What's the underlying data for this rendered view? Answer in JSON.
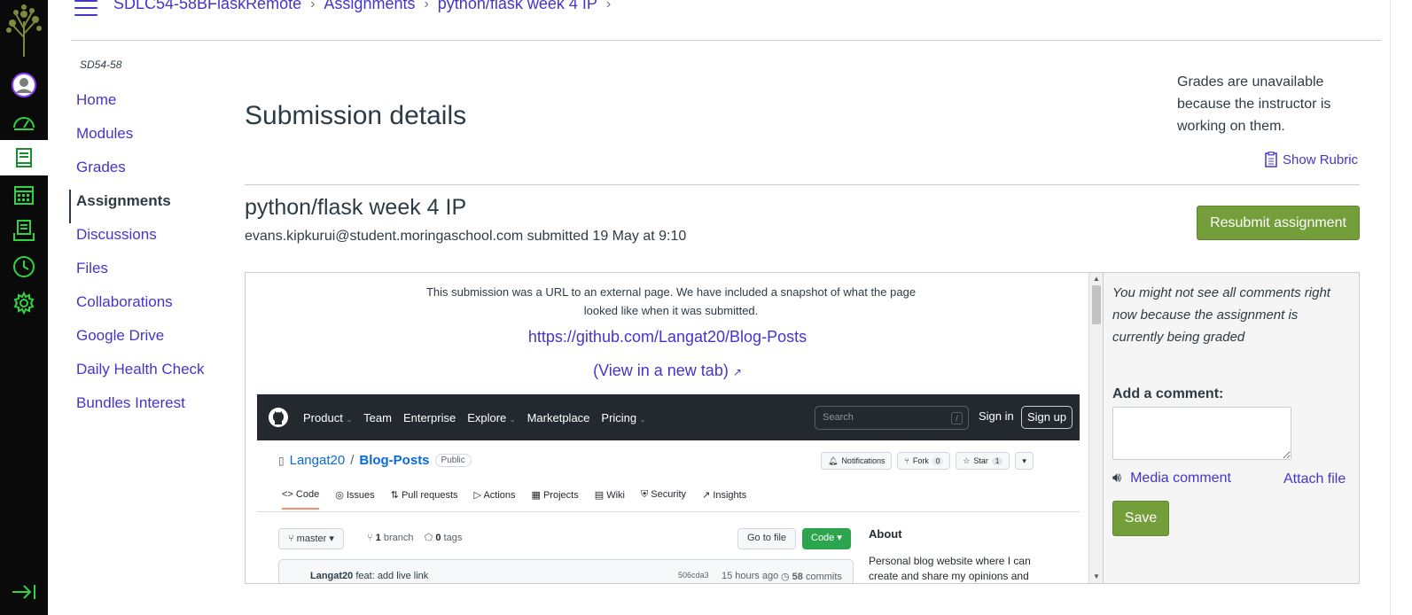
{
  "breadcrumb": {
    "items": [
      "SDLC54-58BFlaskRemote",
      "Assignments",
      "python/flask week 4 IP"
    ]
  },
  "course_nav": {
    "code": "SD54-58",
    "items": [
      {
        "label": "Home"
      },
      {
        "label": "Modules"
      },
      {
        "label": "Grades"
      },
      {
        "label": "Assignments"
      },
      {
        "label": "Discussions"
      },
      {
        "label": "Files"
      },
      {
        "label": "Collaborations"
      },
      {
        "label": "Google Drive"
      },
      {
        "label": "Daily Health Check"
      },
      {
        "label": "Bundles Interest"
      }
    ]
  },
  "page": {
    "title": "Submission details",
    "grades_note": "Grades are unavailable because the instructor is working on them.",
    "show_rubric": "Show Rubric",
    "assignment_name": "python/flask week 4 IP",
    "submitted_line": "evans.kipkurui@student.moringaschool.com submitted 19 May at 9:10",
    "resubmit_label": "Resubmit assignment"
  },
  "snapshot": {
    "note": "This submission was a URL to an external page. We have included a snapshot of what the page looked like when it was submitted.",
    "url": "https://github.com/Langat20/Blog-Posts",
    "new_tab": "(View in a new tab)"
  },
  "github": {
    "menu": [
      "Product",
      "Team",
      "Enterprise",
      "Explore",
      "Marketplace",
      "Pricing"
    ],
    "search_placeholder": "Search",
    "slash": "/",
    "sign_in": "Sign in",
    "sign_up": "Sign up",
    "owner": "Langat20",
    "slash_sep": "/",
    "repo": "Blog-Posts",
    "visibility": "Public",
    "notifications": "Notifications",
    "fork": "Fork",
    "fork_count": "0",
    "star": "Star",
    "star_count": "1",
    "tabs": [
      "Code",
      "Issues",
      "Pull requests",
      "Actions",
      "Projects",
      "Wiki",
      "Security",
      "Insights"
    ],
    "branch": "master",
    "branch_count": "1",
    "branch_word": "branch",
    "tag_count": "0",
    "tag_word": "tags",
    "go_to_file": "Go to file",
    "code_btn": "Code",
    "commit_author": "Langat20",
    "commit_msg": "feat: add live link",
    "commit_sha": "506cda3",
    "commit_ago": "15 hours ago",
    "commit_count": "58",
    "commit_word": "commits",
    "about_title": "About",
    "about_desc": "Personal blog website where I can create and share my opinions and"
  },
  "comments": {
    "note": "You might not see all comments right now because the assignment is currently being graded",
    "add_label": "Add a comment:",
    "media": "Media comment",
    "attach": "Attach file",
    "save": "Save"
  },
  "colors": {
    "link": "#4435c9",
    "nav_bg": "#0a0a0a",
    "nav_icon": "#30d440",
    "button_green": "#749e3a"
  }
}
